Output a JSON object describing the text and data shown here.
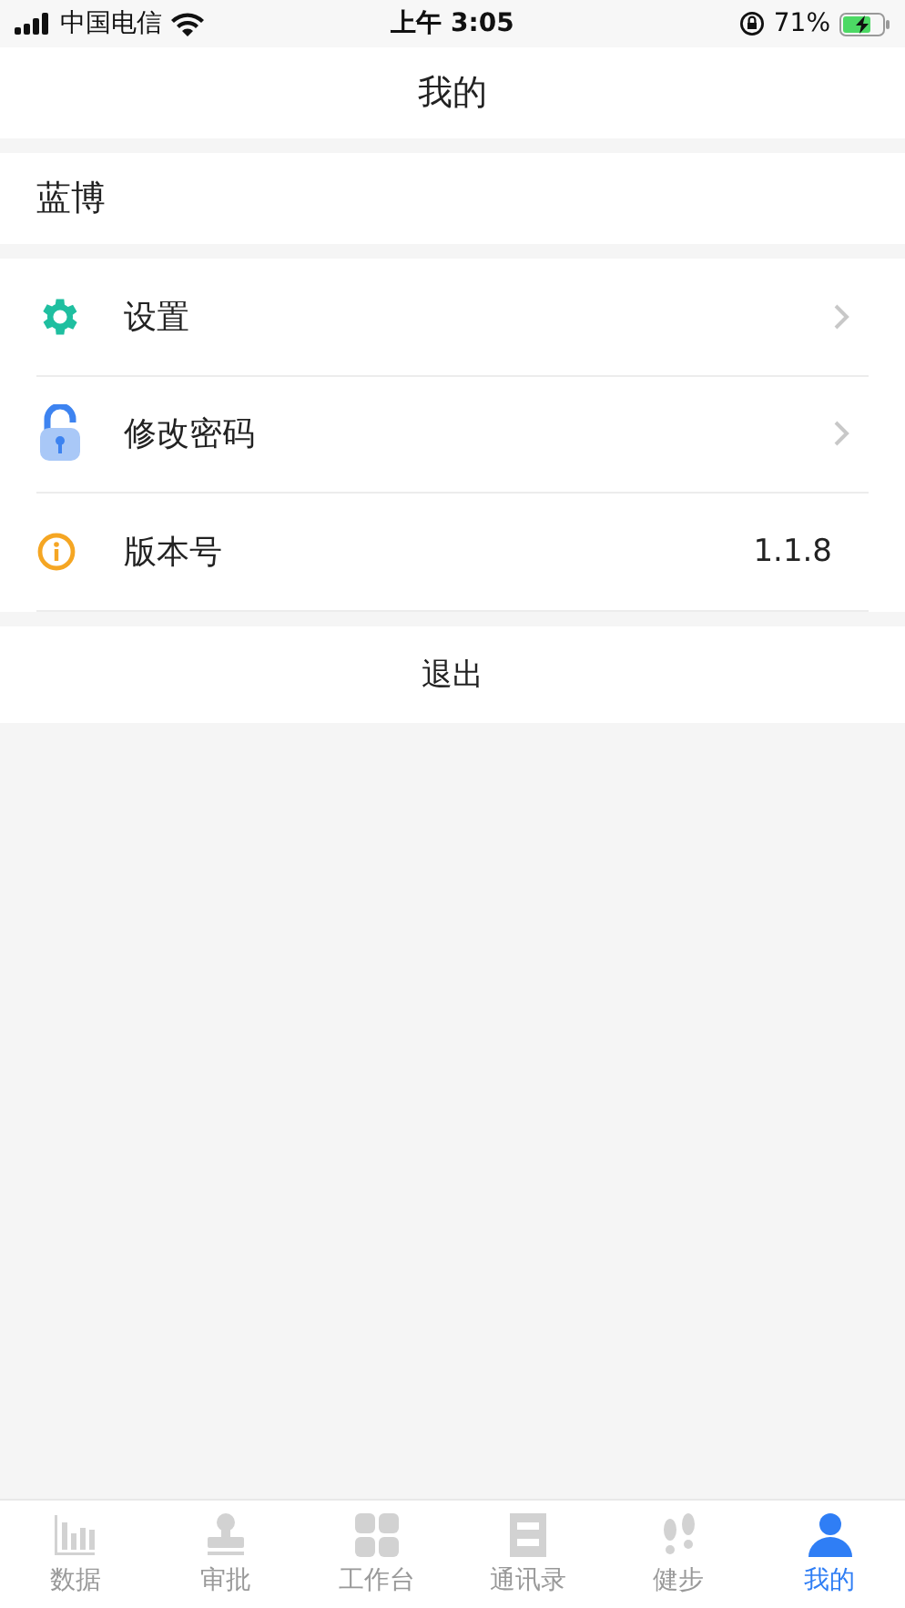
{
  "status_bar": {
    "carrier": "中国电信",
    "time": "上午 3:05",
    "battery": "71%"
  },
  "header": {
    "title": "我的"
  },
  "user": {
    "name": "蓝博"
  },
  "menu": [
    {
      "kind": "settings",
      "label": "设置"
    },
    {
      "kind": "password",
      "label": "修改密码"
    },
    {
      "kind": "version",
      "label": "版本号",
      "value": "1.1.8"
    }
  ],
  "logout": {
    "label": "退出"
  },
  "tabs": [
    {
      "kind": "data",
      "label": "数据",
      "selected": false
    },
    {
      "kind": "approval",
      "label": "审批",
      "selected": false
    },
    {
      "kind": "workbench",
      "label": "工作台",
      "selected": false
    },
    {
      "kind": "contacts",
      "label": "通讯录",
      "selected": false
    },
    {
      "kind": "steps",
      "label": "健步",
      "selected": false
    },
    {
      "kind": "me",
      "label": "我的",
      "selected": true
    }
  ]
}
